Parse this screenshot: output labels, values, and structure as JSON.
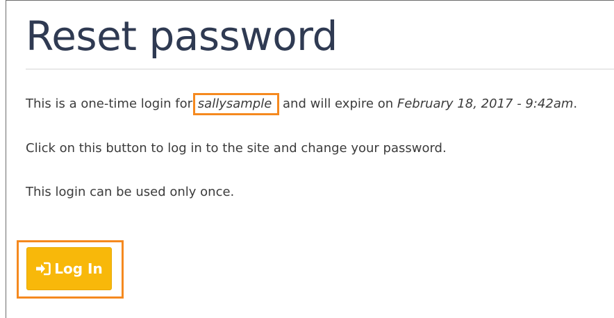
{
  "page": {
    "title": "Reset password"
  },
  "message": {
    "line1_prefix": "This is a one-time login for ",
    "username": "sallysample",
    "line1_middle": " and will expire on ",
    "expiry": "February 18, 2017 - 9:42am",
    "line1_suffix": ".",
    "line2": "Click on this button to log in to the site and change your password.",
    "line3": "This login can be used only once."
  },
  "login_button": {
    "label": "Log In",
    "icon": "sign-in-icon",
    "color": "#f8b80a"
  },
  "highlight_color": "#f5891f"
}
